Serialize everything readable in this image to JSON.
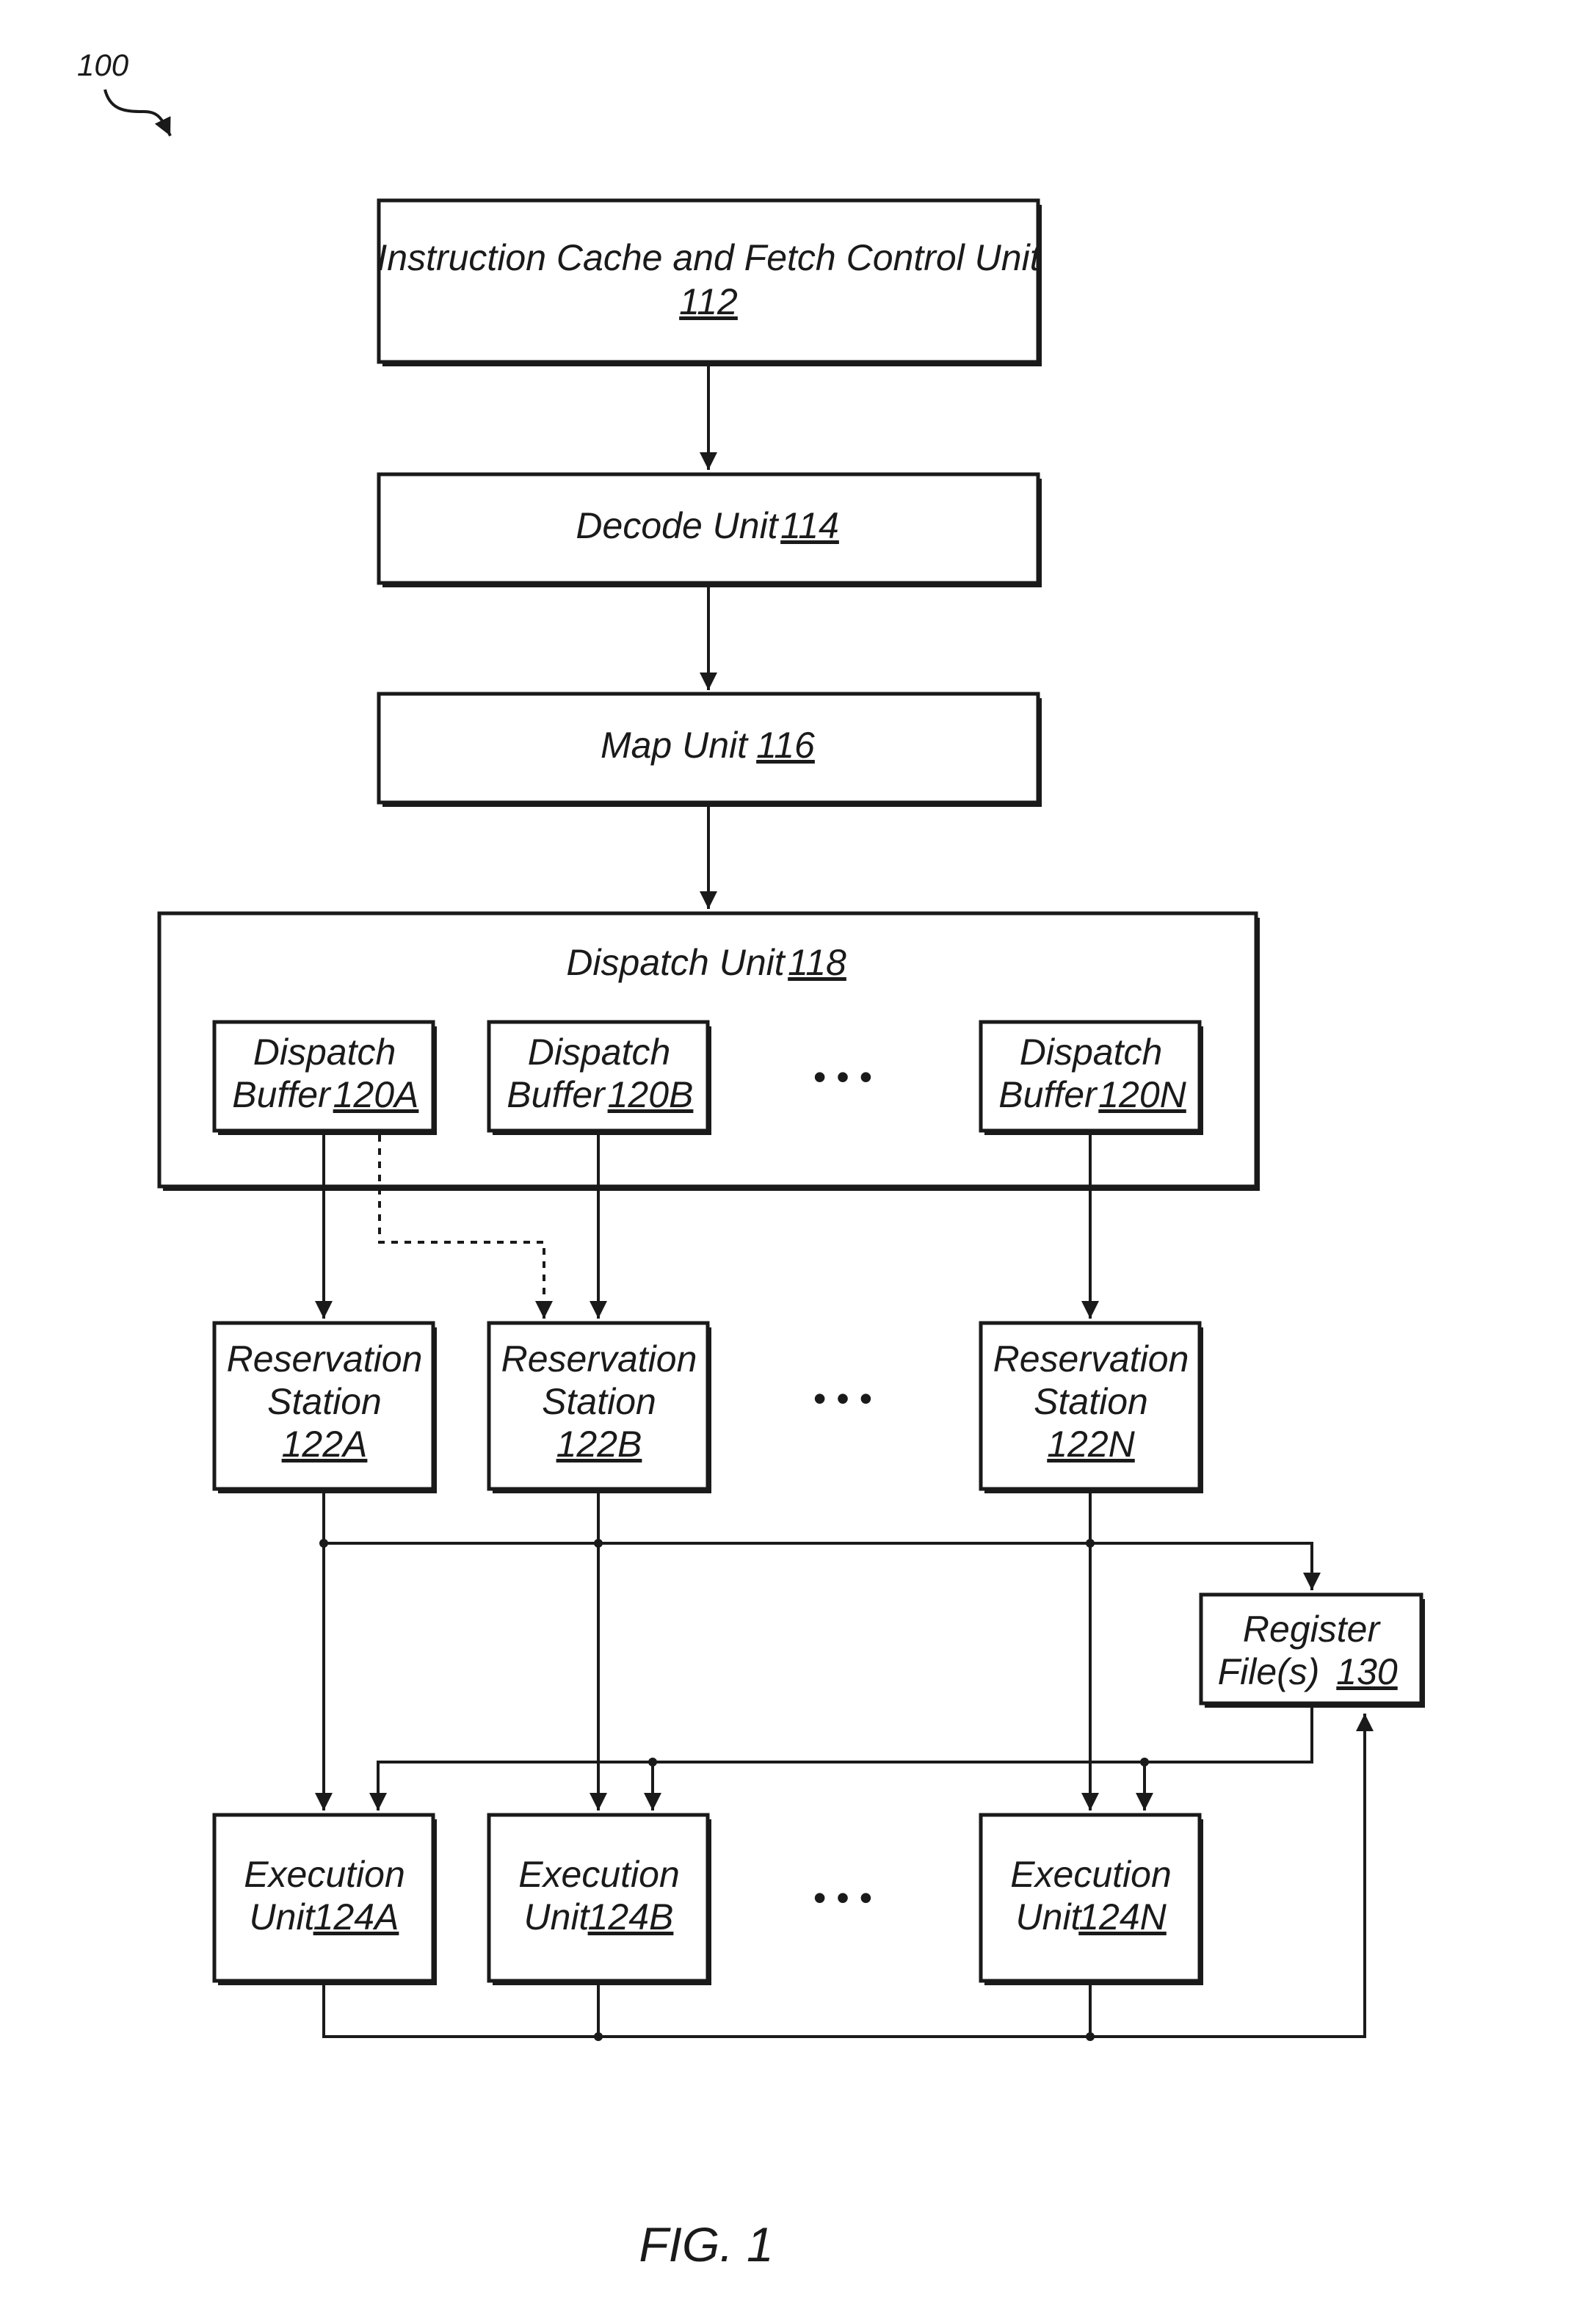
{
  "figure": {
    "reference_numeral": "100",
    "caption": "FIG. 1"
  },
  "blocks": {
    "icache": {
      "name": "Instruction Cache and Fetch Control Unit",
      "ref": "112"
    },
    "decode": {
      "name": "Decode Unit",
      "ref": "114"
    },
    "map": {
      "name": "Map Unit",
      "ref": "116"
    },
    "dispatch": {
      "name": "Dispatch Unit",
      "ref": "118"
    },
    "dispatch_buffers": [
      {
        "line1": "Dispatch",
        "line2": "Buffer",
        "ref": "120A"
      },
      {
        "line1": "Dispatch",
        "line2": "Buffer",
        "ref": "120B"
      },
      {
        "line1": "Dispatch",
        "line2": "Buffer",
        "ref": "120N"
      }
    ],
    "reservation_stations": [
      {
        "line1": "Reservation",
        "line2": "Station",
        "ref": "122A"
      },
      {
        "line1": "Reservation",
        "line2": "Station",
        "ref": "122B"
      },
      {
        "line1": "Reservation",
        "line2": "Station",
        "ref": "122N"
      }
    ],
    "register_file": {
      "line1": "Register",
      "line2": "File(s)",
      "ref": "130"
    },
    "execution_units": [
      {
        "line1": "Execution",
        "line2": "Unit",
        "ref": "124A"
      },
      {
        "line1": "Execution",
        "line2": "Unit",
        "ref": "124B"
      },
      {
        "line1": "Execution",
        "line2": "Unit",
        "ref": "124N"
      }
    ]
  },
  "ellipsis": "• • •"
}
